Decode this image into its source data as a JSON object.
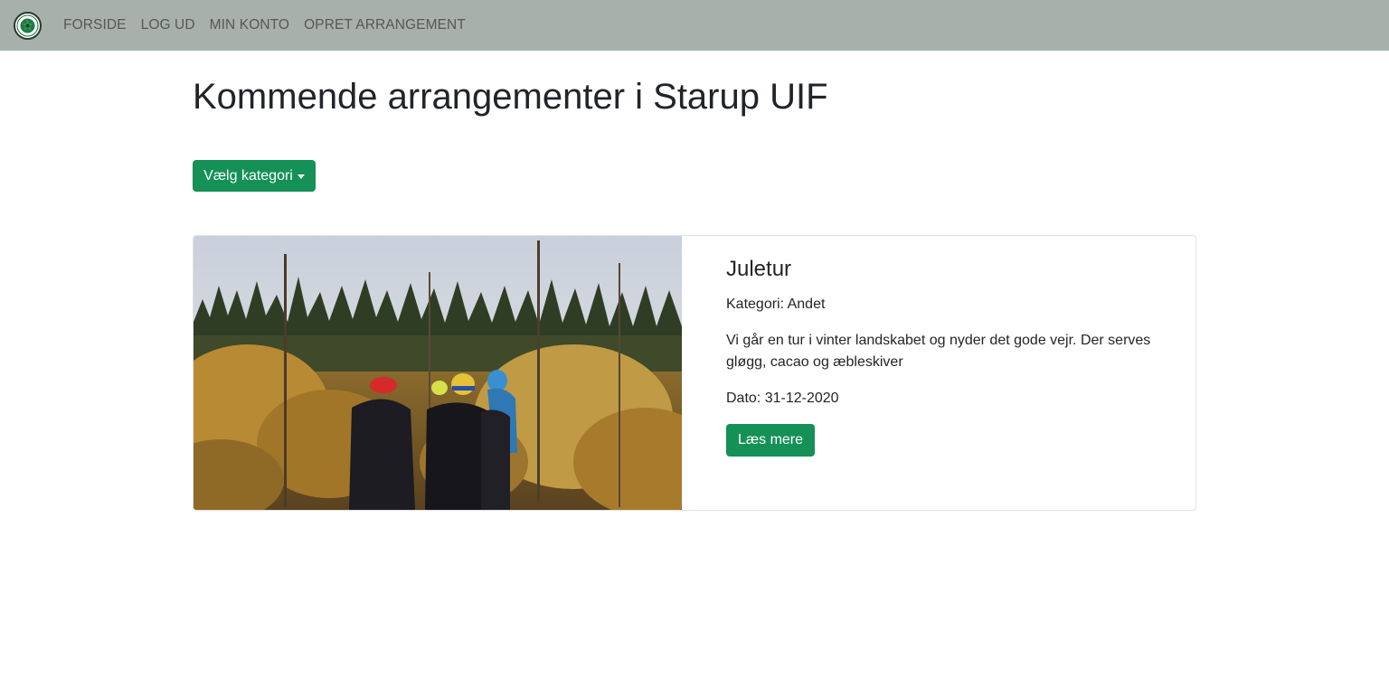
{
  "nav": {
    "logo": "club-logo",
    "links": [
      "FORSIDE",
      "LOG UD",
      "MIN KONTO",
      "OPRET ARRANGEMENT"
    ]
  },
  "main": {
    "title": "Kommende arrangementer i Starup UIF",
    "category_dropdown_label": "Vælg kategori"
  },
  "events": [
    {
      "title": "Juletur",
      "category": "Kategori: Andet",
      "description": "Vi går en tur i vinter landskabet og nyder det gode vejr. Der serves gløgg, cacao og æbleskiver",
      "date": "Dato: 31-12-2020",
      "button_label": "Læs mere"
    }
  ],
  "colors": {
    "navbar_bg": "#a7b0ab",
    "accent_green": "#159157",
    "text": "#212529"
  }
}
